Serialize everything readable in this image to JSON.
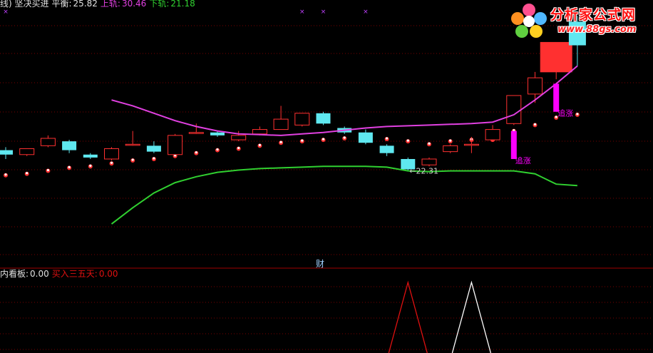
{
  "header": {
    "indicator_name": "线) 坚决买进",
    "balance_label": "平衡:",
    "balance_value": "25.82",
    "upper_label": "上轨:",
    "upper_value": "30.46",
    "lower_label": "下轨:",
    "lower_value": "21.18"
  },
  "sub_header": {
    "name": "内看板:",
    "name_value": "0.00",
    "buy_label": "买入三五天:",
    "buy_value": "0.00"
  },
  "logo": {
    "title": "分析家公式网",
    "url": "www.88gs.com"
  },
  "divider_label": "财",
  "colors": {
    "background": "#000000",
    "up_candle": "#ff3030",
    "down_candle": "#5fe8f0",
    "upper_band": "#e040e0",
    "lower_band": "#30d030",
    "signal_bar": "#ff00ff",
    "grid": "#7a0000",
    "sub_red": "#e01010",
    "sub_white": "#ffffff"
  },
  "chart_data": {
    "type": "candlestick",
    "ylim": [
      18.5,
      35.5
    ],
    "candles": [
      {
        "o": 26.2,
        "h": 26.4,
        "l": 25.6,
        "c": 25.9
      },
      {
        "o": 25.9,
        "h": 26.3,
        "l": 25.8,
        "c": 26.3
      },
      {
        "o": 26.5,
        "h": 27.2,
        "l": 26.4,
        "c": 27.0
      },
      {
        "o": 26.8,
        "h": 26.9,
        "l": 26.0,
        "c": 26.2
      },
      {
        "o": 25.9,
        "h": 26.0,
        "l": 25.6,
        "c": 25.7
      },
      {
        "o": 25.6,
        "h": 26.4,
        "l": 25.5,
        "c": 26.3
      },
      {
        "o": 26.6,
        "h": 27.5,
        "l": 26.5,
        "c": 26.6
      },
      {
        "o": 26.5,
        "h": 26.8,
        "l": 26.0,
        "c": 26.1
      },
      {
        "o": 25.9,
        "h": 27.3,
        "l": 25.9,
        "c": 27.2
      },
      {
        "o": 27.4,
        "h": 28.0,
        "l": 27.3,
        "c": 27.4
      },
      {
        "o": 27.4,
        "h": 27.5,
        "l": 27.1,
        "c": 27.2
      },
      {
        "o": 26.9,
        "h": 27.5,
        "l": 26.8,
        "c": 27.2
      },
      {
        "o": 27.3,
        "h": 27.8,
        "l": 27.2,
        "c": 27.6
      },
      {
        "o": 27.6,
        "h": 29.2,
        "l": 27.6,
        "c": 28.3
      },
      {
        "o": 27.9,
        "h": 28.7,
        "l": 27.8,
        "c": 28.7
      },
      {
        "o": 28.7,
        "h": 28.8,
        "l": 27.9,
        "c": 28.0
      },
      {
        "o": 27.7,
        "h": 27.8,
        "l": 27.3,
        "c": 27.4
      },
      {
        "o": 27.4,
        "h": 27.6,
        "l": 26.6,
        "c": 26.7
      },
      {
        "o": 26.5,
        "h": 26.6,
        "l": 25.8,
        "c": 26.0
      },
      {
        "o": 25.6,
        "h": 25.7,
        "l": 24.8,
        "c": 24.9
      },
      {
        "o": 25.2,
        "h": 25.7,
        "l": 25.1,
        "c": 25.6
      },
      {
        "o": 26.1,
        "h": 26.6,
        "l": 26.0,
        "c": 26.5
      },
      {
        "o": 26.6,
        "h": 27.1,
        "l": 26.0,
        "c": 26.6
      },
      {
        "o": 26.9,
        "h": 27.9,
        "l": 26.8,
        "c": 27.6
      },
      {
        "o": 28.0,
        "h": 29.9,
        "l": 27.9,
        "c": 29.9
      },
      {
        "o": 30.0,
        "h": 31.5,
        "l": 29.4,
        "c": 31.1
      },
      {
        "o": 31.5,
        "h": 33.5,
        "l": 31.0,
        "c": 33.5
      },
      {
        "o": 34.9,
        "h": 35.3,
        "l": 31.9,
        "c": 33.3
      }
    ],
    "upper_band": [
      null,
      null,
      null,
      null,
      null,
      29.6,
      29.2,
      28.7,
      28.2,
      27.8,
      27.5,
      27.3,
      27.25,
      27.2,
      27.3,
      27.4,
      27.55,
      27.7,
      27.8,
      27.85,
      27.9,
      27.95,
      28.0,
      28.1,
      28.6,
      29.6,
      30.7,
      31.9
    ],
    "lower_band": [
      null,
      null,
      null,
      null,
      null,
      21.2,
      22.3,
      23.3,
      24.0,
      24.4,
      24.7,
      24.85,
      24.95,
      25.0,
      25.05,
      25.1,
      25.1,
      25.1,
      25.05,
      24.8,
      24.75,
      24.8,
      24.8,
      24.8,
      24.8,
      24.6,
      23.9,
      23.8
    ],
    "dots": [
      24.5,
      24.6,
      24.8,
      25.0,
      25.1,
      25.3,
      25.5,
      25.6,
      25.8,
      26.0,
      26.2,
      26.3,
      26.5,
      26.7,
      26.8,
      26.9,
      27.0,
      27.1,
      26.95,
      26.8,
      26.6,
      26.8,
      26.9,
      26.9,
      27.5,
      27.9,
      28.4,
      28.6
    ],
    "zhuizhang": [
      {
        "index": 24,
        "top": 27.5,
        "bottom": 25.6,
        "label": "追涨"
      },
      {
        "index": 26,
        "top": 30.7,
        "bottom": 28.8,
        "label": "追涨"
      }
    ],
    "annotation": {
      "index": 19,
      "value": 24.8,
      "label": "22.31"
    },
    "top_markers": [
      0,
      14,
      15,
      17
    ],
    "sub_series": [
      {
        "name": "red",
        "peak_index": 19
      },
      {
        "name": "white",
        "peak_index": 22
      }
    ]
  }
}
